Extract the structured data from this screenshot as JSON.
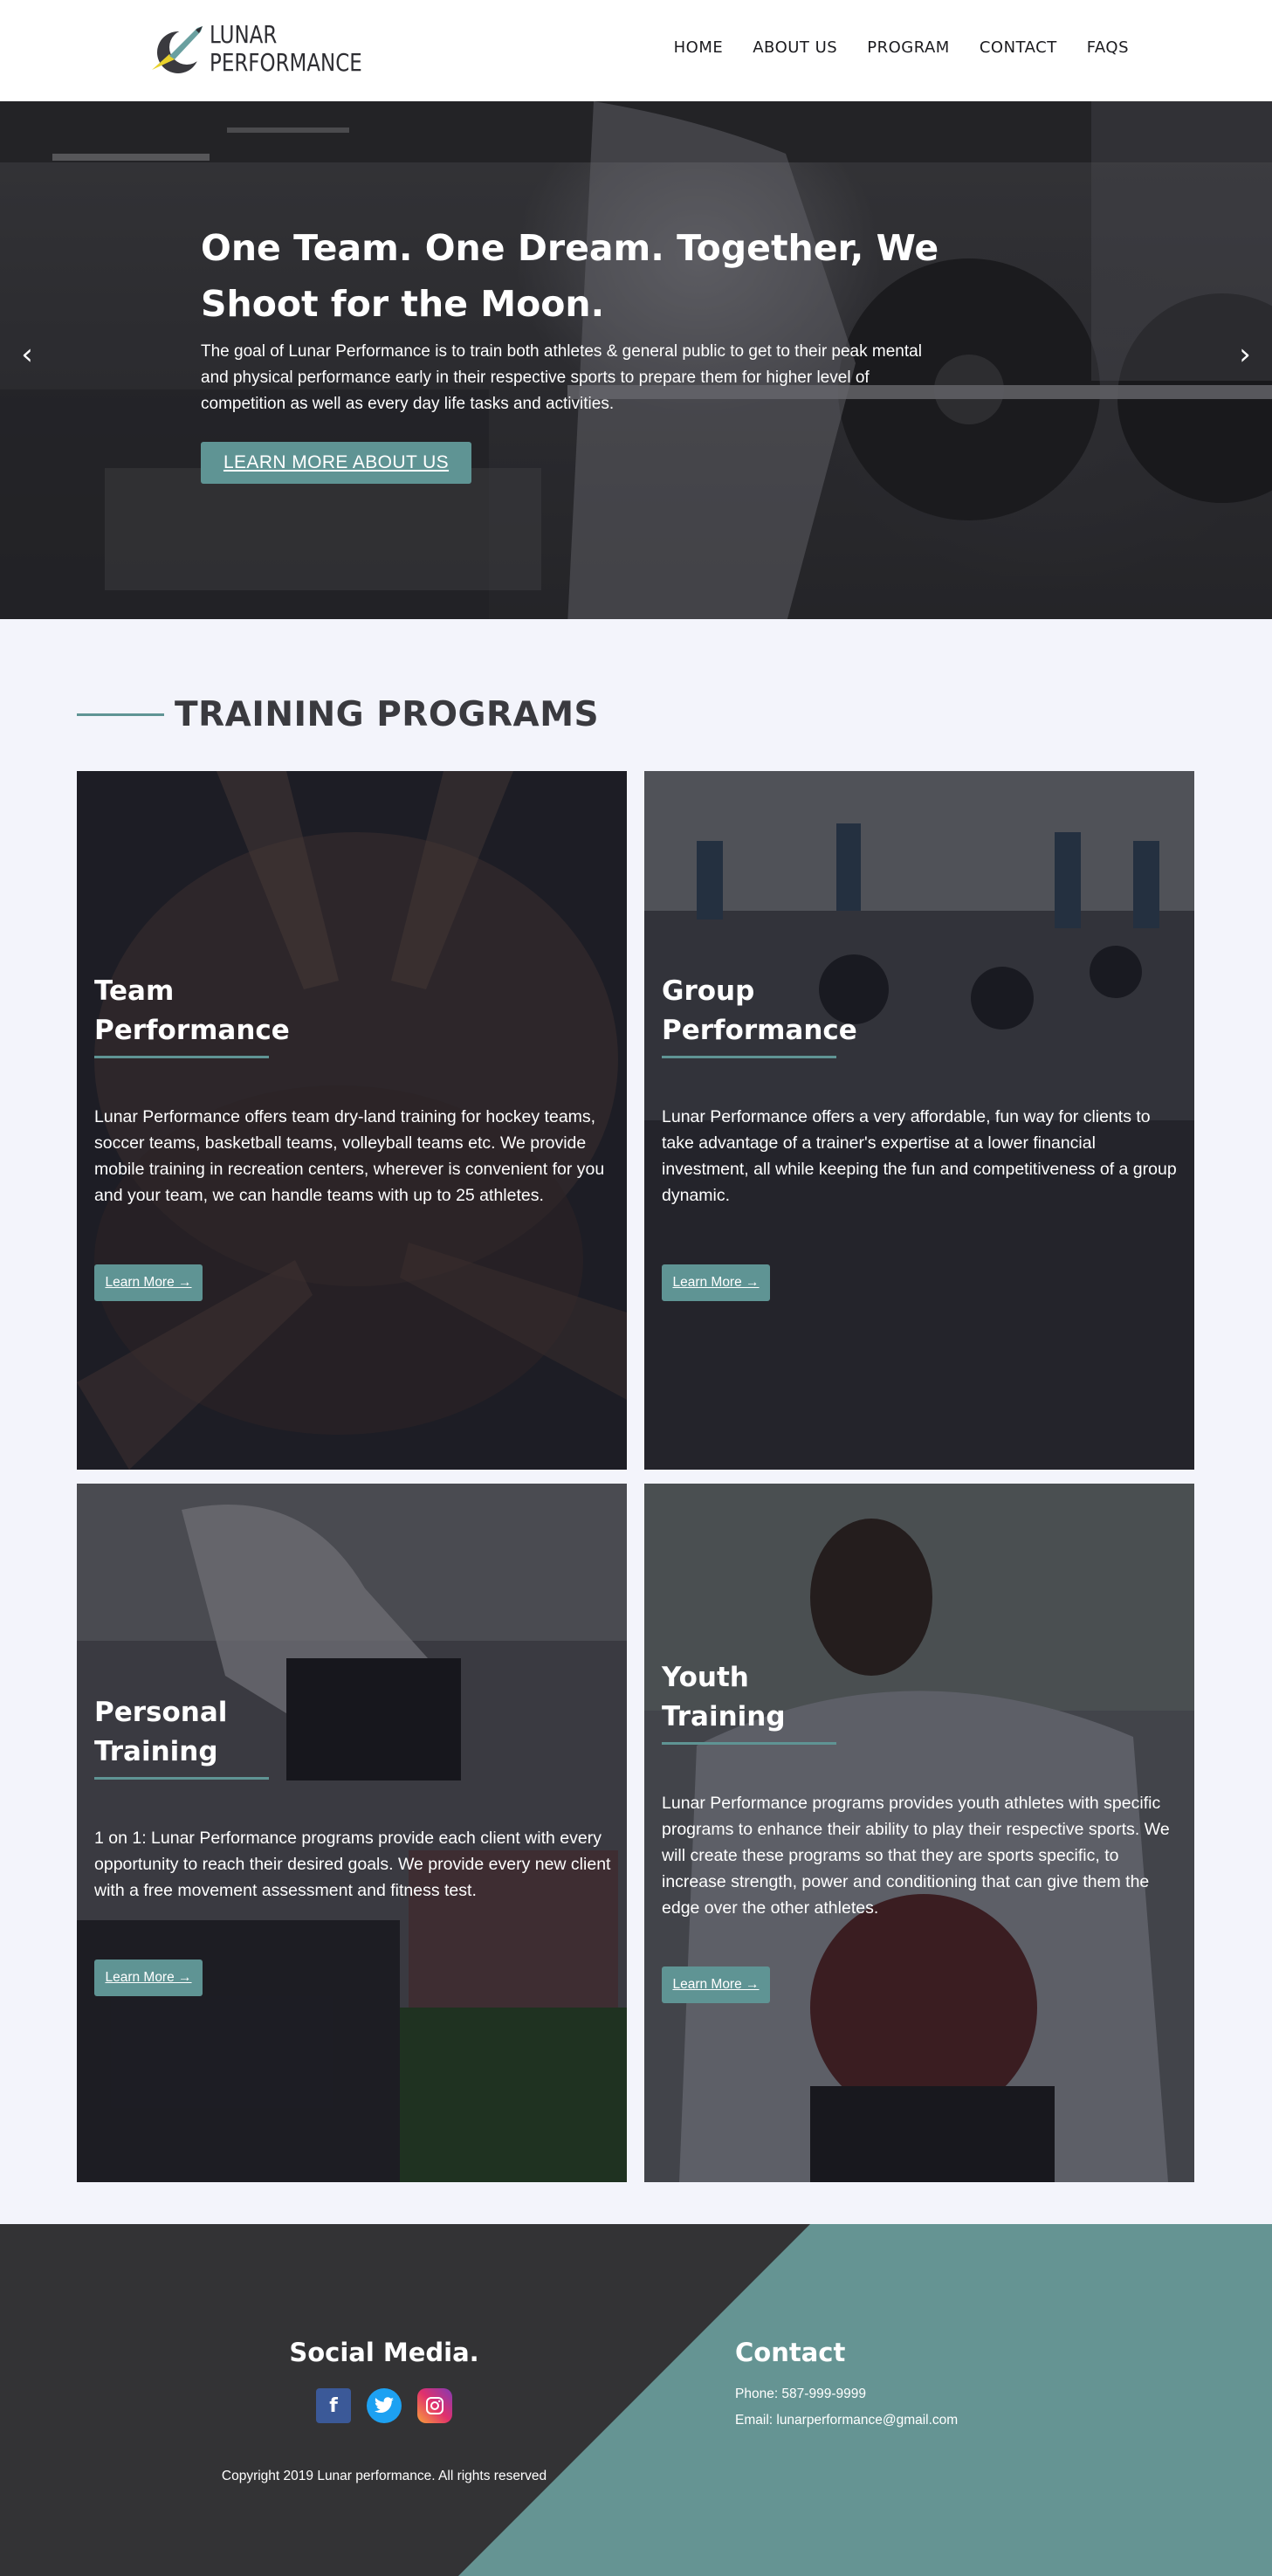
{
  "header": {
    "logo_line1": "LUNAR",
    "logo_line2": "PERFORMANCE",
    "nav": [
      "HOME",
      "ABOUT US",
      "PROGRAM",
      "CONTACT",
      "FAQS"
    ]
  },
  "hero": {
    "title": "One Team. One Dream. Together, We Shoot for the Moon.",
    "text": "The goal of Lunar Performance is to train both athletes & general public to get to their peak mental and physical performance early in their respective sports to prepare them for higher level of competition as well as every day life tasks and activities.",
    "button": "LEARN MORE ABOUT US",
    "prev_icon": "chevron-left-icon",
    "next_icon": "chevron-right-icon"
  },
  "programs": {
    "title": "TRAINING PROGRAMS",
    "cards": [
      {
        "title": "Team Performance",
        "text": "Lunar Performance offers team dry-land training for hockey teams, soccer teams, basketball teams, volleyball teams etc. We provide mobile training in recreation centers, wherever is convenient for you and your team, we can handle teams with up to 25 athletes.",
        "button": "Learn More →"
      },
      {
        "title": "Group Performance",
        "text": "Lunar Performance offers a very affordable, fun way for clients to take advantage of a trainer's expertise at a lower financial investment, all while keeping the fun and competitiveness of a group dynamic.",
        "button": "Learn More →"
      },
      {
        "title": "Personal Training",
        "text": "1 on 1: Lunar Performance programs provide each client with every opportunity to reach their desired goals. We provide every new client with a free movement assessment and fitness test.",
        "button": "Learn More →"
      },
      {
        "title": "Youth Training",
        "text": "Lunar Performance programs provides youth athletes with specific programs to enhance their ability to play their respective sports. We will create these programs so that they are sports specific, to increase strength, power and conditioning that can give them the edge over the other athletes.",
        "button": "Learn More →"
      }
    ]
  },
  "footer": {
    "social_title": "Social Media.",
    "social_icons": [
      "facebook-icon",
      "twitter-icon",
      "instagram-icon"
    ],
    "copyright": "Copyright 2019 Lunar performance. All rights reserved",
    "contact_title": "Contact",
    "phone": "Phone: 587-999-9999",
    "email": "Email: lunarperformance@gmail.com"
  },
  "colors": {
    "accent": "#5f9494",
    "footer_dark": "#333335",
    "heading_dark": "#3a3a3f",
    "page_bg": "#f3f4fb"
  }
}
